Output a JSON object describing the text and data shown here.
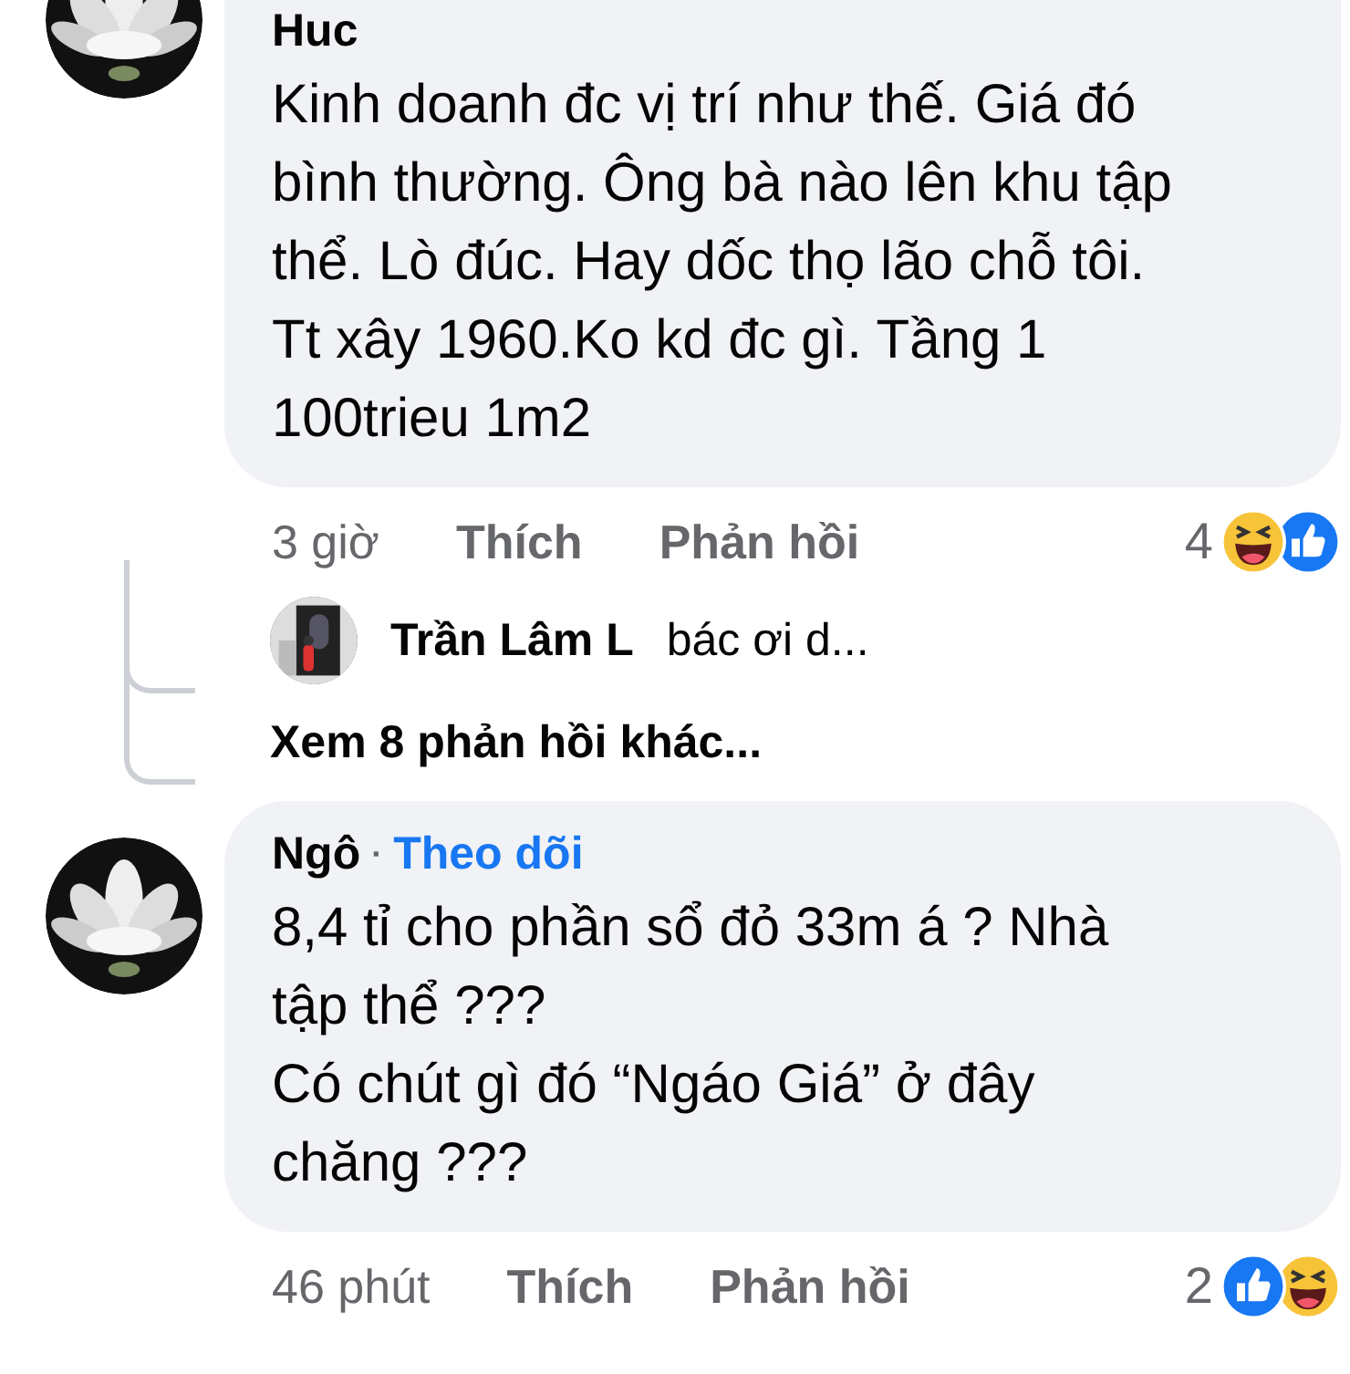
{
  "comments": [
    {
      "author": "Huc",
      "lines": [
        "Kinh doanh đc vị trí như thế. Giá đó",
        "bình thường. Ông bà nào lên khu tập",
        "thể. Lò đúc. Hay dốc thọ lão chỗ tôi.",
        "Tt xây 1960.Ko kd đc gì. Tầng 1",
        "100trieu 1m2"
      ],
      "time": "3 giờ",
      "like": "Thích",
      "reply": "Phản hồi",
      "reaction_count": "4",
      "reactions": [
        {
          "kind": "haha"
        },
        {
          "kind": "like"
        }
      ],
      "replies": {
        "items": [
          {
            "author": "Trần Lâm L",
            "preview": "bác ơi d..."
          }
        ],
        "more": "Xem 8 phản hồi khác..."
      }
    },
    {
      "author": "Ngô",
      "separator": "·",
      "follow": "Theo dõi",
      "lines": [
        "8,4 tỉ cho phần sổ đỏ 33m á ? Nhà",
        "tập thể ???",
        "Có chút gì đó “Ngáo Giá” ở đây",
        "chăng ???"
      ],
      "time": "46 phút",
      "like": "Thích",
      "reply": "Phản hồi",
      "reaction_count": "2",
      "reactions": [
        {
          "kind": "like"
        },
        {
          "kind": "haha"
        }
      ]
    }
  ]
}
